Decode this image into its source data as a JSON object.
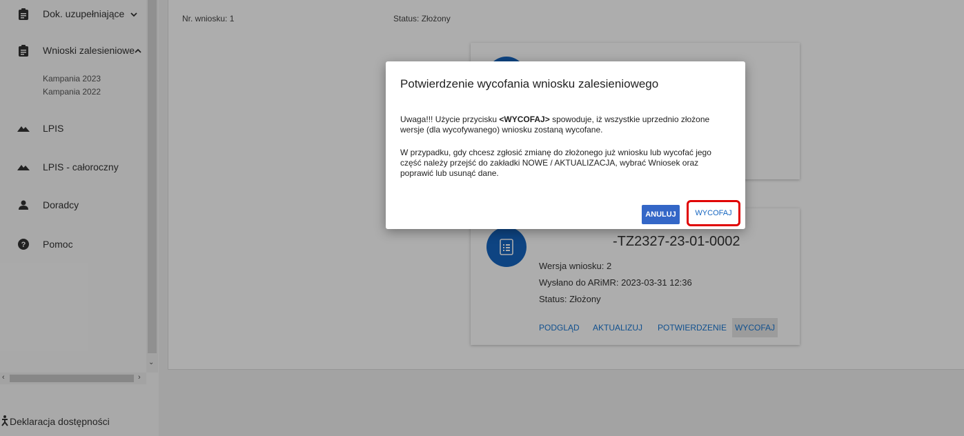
{
  "sidebar": {
    "items": [
      {
        "label": "Dok. uzupełniające",
        "icon": "clipboard-icon"
      },
      {
        "label": "Wnioski zalesieniowe",
        "icon": "clipboard-icon"
      },
      {
        "label": "LPIS",
        "icon": "mountain-icon"
      },
      {
        "label": "LPIS - całoroczny",
        "icon": "mountain-icon"
      },
      {
        "label": "Doradcy",
        "icon": "person-icon"
      },
      {
        "label": "Pomoc",
        "icon": "help-icon"
      }
    ],
    "sub_items": [
      "Kampania 2023",
      "Kampania 2022"
    ],
    "bottom": {
      "label": "Deklaracja dostępności",
      "icon": "accessibility-icon"
    }
  },
  "main": {
    "top_meta": {
      "number": "Nr. wniosku: 1",
      "status": "Status: Złożony"
    },
    "card": {
      "title": "-TZ2327-23-01-0002",
      "version": "Wersja wniosku: 2",
      "sent": "Wysłano do ARiMR: 2023-03-31 12:36",
      "status": "Status: Złożony",
      "buttons": [
        "PODGLĄD",
        "AKTUALIZUJ",
        "POTWIERDZENIE",
        "WYCOFAJ"
      ]
    }
  },
  "dialog": {
    "title": "Potwierdzenie wycofania wniosku zalesieniowego",
    "p1_pre": "Uwaga!!! Użycie przycisku ",
    "p1_bold": "<WYCOFAJ>",
    "p1_post": " spowoduje, iż wszystkie uprzednio złożone wersje (dla wycofywanego) wniosku zostaną wycofane.",
    "p2": "W przypadku, gdy chcesz zgłosić zmianę do złożonego już wniosku lub wycofać jego część należy przejść do zakładki NOWE / AKTUALIZACJA, wybrać Wniosek oraz poprawić lub usunąć dane.",
    "cancel_label": "ANULUJ",
    "confirm_label": "WYCOFAJ"
  },
  "colors": {
    "accent": "#1565c0",
    "primary_button": "#3467c7",
    "highlight": "#e00000"
  }
}
